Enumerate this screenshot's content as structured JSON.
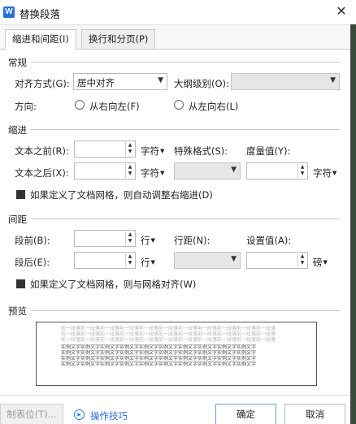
{
  "window": {
    "title": "替换段落",
    "app_icon": "W"
  },
  "tabs": [
    {
      "label": "缩进和间距(I)",
      "active": true
    },
    {
      "label": "换行和分页(P)",
      "active": false
    }
  ],
  "general": {
    "section": "常规",
    "align_label": "对齐方式(G):",
    "align_value": "居中对齐",
    "outline_label": "大纲级别(O):",
    "outline_value": "",
    "direction_label": "方向:",
    "rtl_label": "从右向左(F)",
    "ltr_label": "从左向右(L)"
  },
  "indent": {
    "section": "缩进",
    "before_label": "文本之前(R):",
    "before_value": "",
    "before_unit": "字符",
    "after_label": "文本之后(X):",
    "after_value": "",
    "after_unit": "字符",
    "special_label": "特殊格式(S):",
    "special_value": "",
    "measure_label": "度量值(Y):",
    "measure_value": "",
    "measure_unit": "字符",
    "grid_check_label": "如果定义了文档网格，则自动调整右缩进(D)",
    "grid_checked": true
  },
  "spacing": {
    "section": "间距",
    "before_label": "段前(B):",
    "before_value": "",
    "before_unit": "行",
    "after_label": "段后(E):",
    "after_value": "",
    "after_unit": "行",
    "line_label": "行距(N):",
    "line_value": "",
    "set_label": "设置值(A):",
    "set_value": "",
    "set_unit": "磅",
    "grid_check_label": "如果定义了文档网格，则与网格对齐(W)",
    "grid_checked": true
  },
  "preview": {
    "section": "预览",
    "grey_lines": [
      "前一段落前一段落前一段落前一段落前一段落前一段落前一段落前一段落前一段落前一段落前一段落",
      "前一段落前一段落前一段落前一段落前一段落前一段落前一段落前一段落前一段落前一段落前一段落",
      "前一段落前一段落前一段落前一段落前一段落前一段落前一段落前一段落前一段落前一段落前一段落"
    ],
    "dark_lines": [
      "实例文字实例文字实例文字实例文字实例文字实例文字实例文字实例文字实例文字实例文字",
      "实例文字实例文字实例文字实例文字实例文字实例文字实例文字实例文字实例文字实例文字",
      "实例文字实例文字实例文字实例文字实例文字实例文字实例文字实例文字实例文字实例文字",
      "实例文字实例文字实例文字实例文字实例文字实例文字实例文字实例文字实例文字实例文字"
    ]
  },
  "footer": {
    "tabs_button": "制表位(T)...",
    "tips_link": "操作技巧",
    "ok_button": "确定",
    "cancel_button": "取消"
  },
  "colors": {
    "accent": "#2b6fd6",
    "app_icon_bg": "#2a6fd6"
  }
}
